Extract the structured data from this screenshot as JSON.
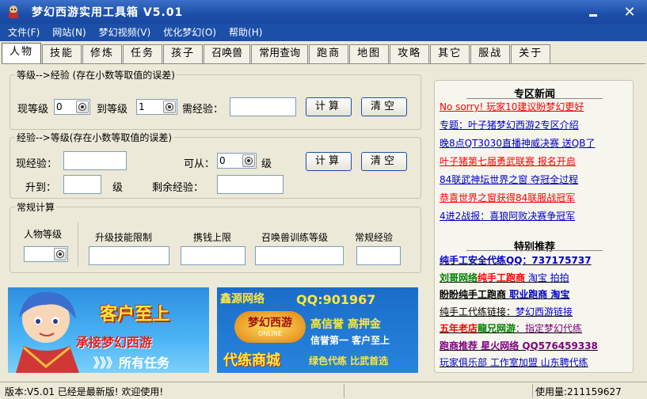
{
  "window": {
    "title": "梦幻西游实用工具箱 V5.01"
  },
  "menu": [
    "文件(F)",
    "网站(N)",
    "梦幻视频(V)",
    "优化梦幻(O)",
    "帮助(H)"
  ],
  "tabs": [
    "人物",
    "技能",
    "修炼",
    "任务",
    "孩子",
    "召唤兽",
    "常用查询",
    "跑商",
    "地图",
    "攻略",
    "其它",
    "服战",
    "关于"
  ],
  "level_to_exp": {
    "legend": "等级-->经验 (存在小数等取值的误差)",
    "current_level_label": "现等级",
    "current_level_value": "0",
    "to_level_label": "到等级",
    "to_level_value": "1",
    "need_exp_label": "需经验：",
    "need_exp_value": "",
    "calc_label": "计算",
    "clear_label": "清空"
  },
  "exp_to_level": {
    "legend": "经验-->等级(存在小数等取值的误差)",
    "current_exp_label": "现经验：",
    "current_exp_value": "",
    "from_label": "可从：",
    "from_value": "0",
    "level_suffix": "级",
    "reach_label": "升到：",
    "reach_value": "",
    "reach_suffix": "级",
    "remain_label": "剩余经验：",
    "remain_value": "",
    "calc_label": "计算",
    "clear_label": "清空"
  },
  "regular_calc": {
    "legend": "常规计算",
    "char_level_label": "人物等级",
    "char_level_value": "",
    "columns": [
      "升级技能限制",
      "携钱上限",
      "召唤兽训练等级",
      "常规经验"
    ]
  },
  "banner1": {
    "title": "客户至上",
    "subtitle": "承接梦幻西游",
    "tagline": "》》》所有任务"
  },
  "banner2": {
    "brand": "鑫源网络",
    "qq": "QQ:901967",
    "logo_text": "梦幻西游",
    "logo_sub": "ONLINE",
    "line1": "高信誉 高押金",
    "line2": "信誉第一 客户至上",
    "store": "代练商城",
    "line3": "绿色代练 比武首选"
  },
  "news": {
    "heading1": "专区新闻",
    "items1": [
      {
        "text": "No sorry! 玩家10建议盼梦幻更好",
        "color": "#FF0000"
      },
      {
        "text": "专题：叶子猪梦幻西游2专区介绍",
        "color": "#0000CC"
      },
      {
        "text": "晚8点QT3030直播神威决赛 送QB了",
        "color": "#0000CC"
      },
      {
        "text": "叶子猪第七届勇武联赛 报名开启",
        "color": "#FF0000"
      },
      {
        "text": "84联武神坛世界之窗 夺冠全过程",
        "color": "#0000CC"
      },
      {
        "text": "恭喜世界之窗获得84联服战冠军",
        "color": "#FF0000"
      },
      {
        "text": "4进2战报：喜狼阿败决赛争冠军",
        "color": "#0000CC"
      }
    ],
    "heading2": "特别推荐",
    "items2": [
      {
        "parts": [
          {
            "text": "纯手工安全代练QQ：737175737",
            "color": "#0000CC",
            "bold": true
          }
        ]
      },
      {
        "parts": [
          {
            "text": "刘哥网络",
            "color": "#008000",
            "bold": true
          },
          {
            "text": "纯手工跑商",
            "color": "#FF0000",
            "bold": true
          },
          {
            "text": " 淘宝 拍拍",
            "color": "#0000CC",
            "bold": false
          }
        ]
      },
      {
        "parts": [
          {
            "text": "盼盼纯手工跑商 ",
            "color": "#000000",
            "bold": true
          },
          {
            "text": "职业跑商 淘宝",
            "color": "#0000CC",
            "bold": true
          }
        ]
      },
      {
        "parts": [
          {
            "text": "纯手工代练链接：",
            "color": "#000000",
            "bold": false
          },
          {
            "text": "梦幻西游链接",
            "color": "#0000CC",
            "bold": false
          }
        ]
      },
      {
        "parts": [
          {
            "text": "五年老店",
            "color": "#FF0000",
            "bold": true
          },
          {
            "text": "龍兄网游",
            "color": "#008000",
            "bold": true
          },
          {
            "text": "：指定梦幻代练",
            "color": "#800080",
            "bold": false
          }
        ]
      },
      {
        "parts": [
          {
            "text": "跑商推荐 星火网络 QQ576459338",
            "color": "#800080",
            "bold": true
          }
        ]
      },
      {
        "parts": [
          {
            "text": "玩家俱乐部 工作室加盟 山东聘代练",
            "color": "#0000CC",
            "bold": false
          }
        ]
      }
    ]
  },
  "status": {
    "left": "版本:V5.01 已经是最新版! 欢迎使用!",
    "right": "使用量:211159627"
  },
  "colors": {
    "titlebar": "#1C4FA8",
    "menubar": "#1C4FA8",
    "background": "#ECE9D8"
  }
}
